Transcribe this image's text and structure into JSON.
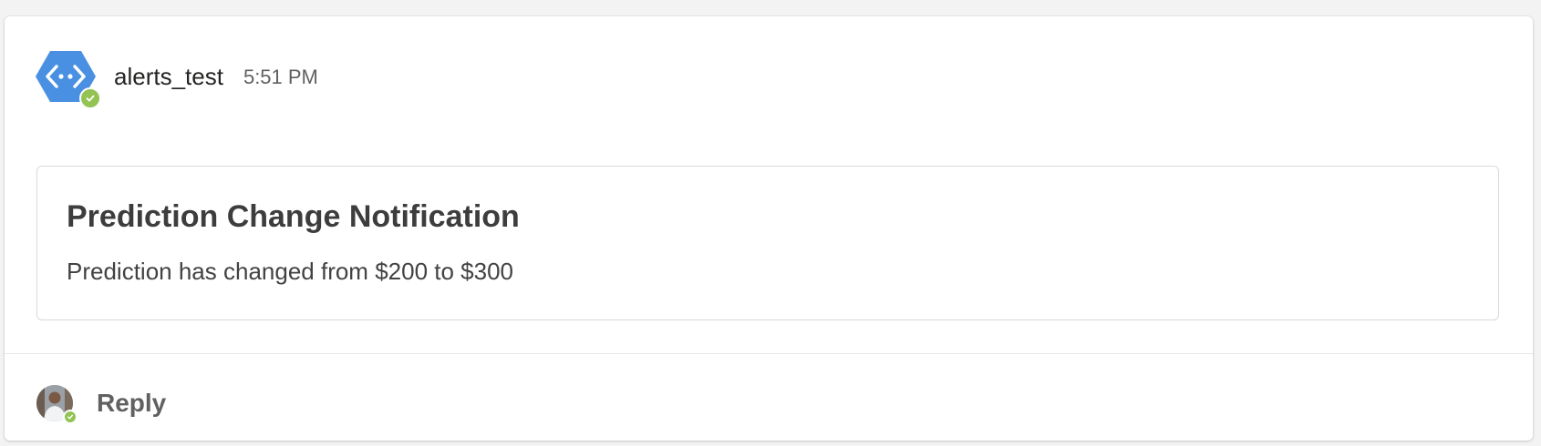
{
  "message": {
    "sender": "alerts_test",
    "timestamp": "5:51 PM",
    "bot_avatar_icon": "code-brackets-icon",
    "presence_status": "available"
  },
  "card": {
    "title": "Prediction Change Notification",
    "body": "Prediction has changed from $200 to $300"
  },
  "reply": {
    "label": "Reply",
    "user_avatar": "user-photo"
  },
  "colors": {
    "bot_avatar": "#4a90e2",
    "presence": "#92c353",
    "card_border": "#d9d9d9",
    "background": "#f3f3f3"
  }
}
